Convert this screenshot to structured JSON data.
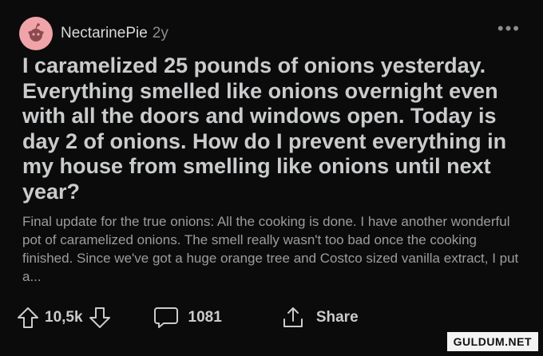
{
  "post": {
    "author": "NectarinePie",
    "age": "2y",
    "more_label": "•••",
    "title": "I caramelized 25 pounds of onions yesterday. Everything smelled like onions overnight even with all the doors and windows open. Today is day 2 of onions. How do I prevent everything in my house from smelling like onions until next year?",
    "body": "Final update for the true onions: All the cooking is done. I have another wonderful pot of caramelized onions. The smell really wasn't too bad once the cooking finished. Since we've got a huge orange tree and Costco sized vanilla extract, I put a..."
  },
  "actions": {
    "votes": "10,5k",
    "comments": "1081",
    "share_label": "Share"
  },
  "watermark": "GULDUM.NET",
  "colors": {
    "background": "#0b0b0b",
    "avatar": "#f0a3a8",
    "text_primary": "#c9cbcd",
    "text_secondary": "#9a9c9e"
  }
}
